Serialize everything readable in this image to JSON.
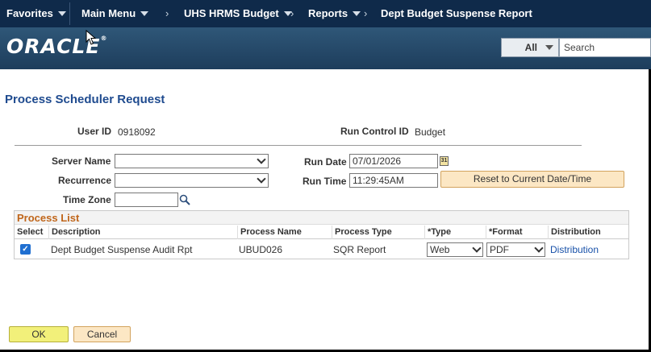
{
  "nav": {
    "favorites": "Favorites",
    "main_menu": "Main Menu",
    "breadcrumb": [
      "UHS HRMS Budget",
      "Reports",
      "Dept Budget Suspense Report"
    ]
  },
  "header": {
    "logo": "ORACLE",
    "search_scope": "All",
    "search_placeholder": "Search"
  },
  "page": {
    "title": "Process Scheduler Request",
    "user_id_label": "User ID",
    "user_id": "0918092",
    "run_control_label": "Run Control ID",
    "run_control": "Budget",
    "server_name_label": "Server Name",
    "recurrence_label": "Recurrence",
    "time_zone_label": "Time Zone",
    "run_date_label": "Run Date",
    "run_date": "07/01/2026",
    "run_time_label": "Run Time",
    "run_time": "11:29:45AM",
    "reset_button": "Reset to Current Date/Time"
  },
  "process_list": {
    "title": "Process List",
    "columns": [
      "Select",
      "Description",
      "Process Name",
      "Process Type",
      "*Type",
      "*Format",
      "Distribution"
    ],
    "rows": [
      {
        "selected": true,
        "description": "Dept Budget Suspense Audit Rpt",
        "process_name": "UBUD026",
        "process_type": "SQR Report",
        "type": "Web",
        "format": "PDF",
        "distribution": "Distribution"
      }
    ]
  },
  "buttons": {
    "ok": "OK",
    "cancel": "Cancel"
  }
}
